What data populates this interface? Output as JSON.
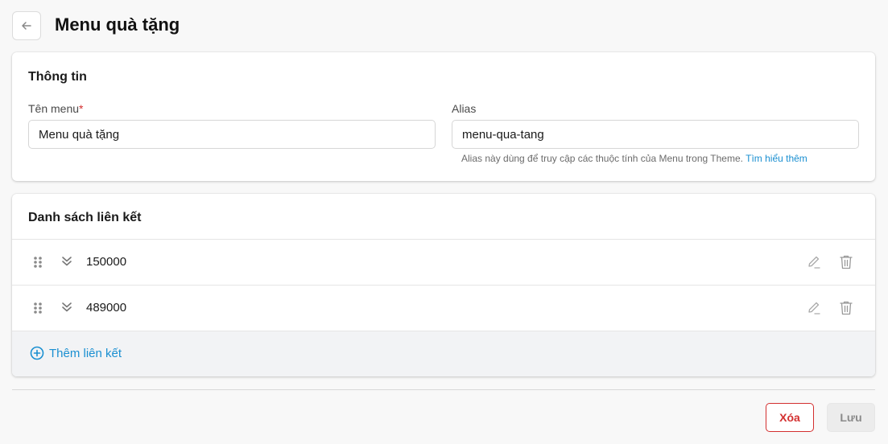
{
  "header": {
    "title": "Menu quà tặng"
  },
  "info": {
    "title": "Thông tin",
    "name_label": "Tên menu",
    "required_mark": "*",
    "name_value": "Menu quà tặng",
    "alias_label": "Alias",
    "alias_value": "menu-qua-tang",
    "hint_text": "Alias này dùng để truy cập các thuộc tính của Menu trong Theme. ",
    "hint_link": "Tìm hiểu thêm"
  },
  "links": {
    "title": "Danh sách liên kết",
    "items": [
      {
        "label": "150000"
      },
      {
        "label": "489000"
      }
    ],
    "add_label": "Thêm liên kết"
  },
  "footer": {
    "delete_label": "Xóa",
    "save_label": "Lưu"
  },
  "colors": {
    "accent": "#1a8fd1",
    "danger": "#d32f2f"
  },
  "icons": [
    "back-arrow-icon",
    "drag-handle-icon",
    "chevron-double-down-icon",
    "edit-icon",
    "trash-icon",
    "plus-circle-icon"
  ]
}
